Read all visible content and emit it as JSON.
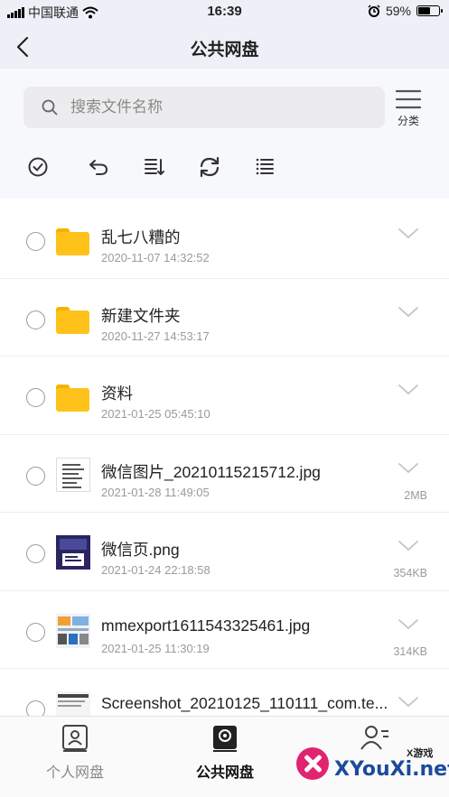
{
  "status_bar": {
    "carrier": "中国联通",
    "time": "16:39",
    "battery_percent": "59%",
    "battery_level": 0.59,
    "icons": [
      "signal-icon",
      "wifi-icon",
      "alarm-icon",
      "battery-icon"
    ]
  },
  "nav": {
    "title": "公共网盘",
    "back_icon": "chevron-left-icon"
  },
  "search": {
    "placeholder": "搜索文件名称",
    "icon": "search-icon"
  },
  "category": {
    "label": "分类",
    "icon": "menu-icon"
  },
  "toolbar": {
    "icons": [
      "check-circle-icon",
      "undo-icon",
      "sort-icon",
      "refresh-icon",
      "list-icon"
    ]
  },
  "files": [
    {
      "type": "folder",
      "name": "乱七八糟的",
      "date": "2020-11-07 14:32:52",
      "size": ""
    },
    {
      "type": "folder",
      "name": "新建文件夹",
      "date": "2020-11-27 14:53:17",
      "size": ""
    },
    {
      "type": "folder",
      "name": "资料",
      "date": "2021-01-25 05:45:10",
      "size": ""
    },
    {
      "type": "image",
      "name": "微信图片_20210115215712.jpg",
      "date": "2021-01-28 11:49:05",
      "size": "2MB"
    },
    {
      "type": "image",
      "name": "微信页.png",
      "date": "2021-01-24 22:18:58",
      "size": "354KB"
    },
    {
      "type": "image",
      "name": "mmexport1611543325461.jpg",
      "date": "2021-01-25 11:30:19",
      "size": "314KB"
    },
    {
      "type": "image",
      "name": "Screenshot_20210125_110111_com.te...",
      "date": "",
      "size": ""
    }
  ],
  "tabbar": {
    "tabs": [
      {
        "label": "个人网盘",
        "icon": "personal-drive-icon",
        "active": false
      },
      {
        "label": "公共网盘",
        "icon": "public-drive-icon",
        "active": true
      },
      {
        "label": "",
        "icon": "contacts-icon",
        "active": false
      }
    ]
  },
  "watermark": {
    "text": "XYouXi.net",
    "small_text": "X游戏"
  },
  "colors": {
    "header_bg": "#eef0f8",
    "folder": "#ffc21a",
    "text_primary": "#222222",
    "text_secondary": "#9a9a9a"
  }
}
